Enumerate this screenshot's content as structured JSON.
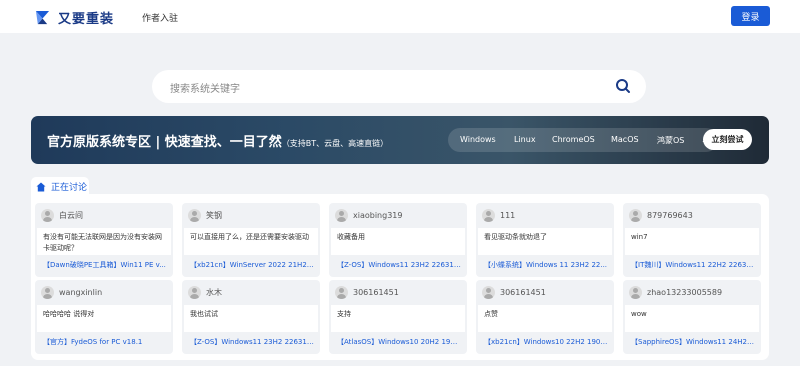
{
  "header": {
    "brand_text": "又要重装",
    "nav_link": "作者入驻",
    "login_label": "登录",
    "logo_icon": "brand-logo-icon"
  },
  "search": {
    "placeholder": "搜索系统关键字",
    "icon": "search-icon"
  },
  "banner": {
    "title": "官方原版系统专区 | 快速查找、一目了然",
    "subtitle": "（支持BT、云盘、高速直链）",
    "os_items": [
      "Windows",
      "Linux",
      "ChromeOS",
      "MacOS",
      "鸿蒙OS",
      "..."
    ],
    "try_label": "立刻尝试"
  },
  "discussion": {
    "tab_label": "正在讨论",
    "tab_icon": "house-icon",
    "cards": [
      {
        "user": "白云间",
        "comment": "有没有可能无法联网是因为没有安装网卡驱动呢？",
        "ref": "【Dawn破晓PE工具箱】Win11 PE v..."
      },
      {
        "user": "笑钢",
        "comment": "可以直接用了么，还是还需要安装驱动",
        "ref": "【xb21cn】WinServer 2022 21H2 ..."
      },
      {
        "user": "xiaobing319",
        "comment": "收藏备用",
        "ref": "【Z-OS】Windows11 23H2 22631...."
      },
      {
        "user": "111",
        "comment": "看见驱动条就劝退了",
        "ref": "【小蝶系统】Windows 11 23H2 22..."
      },
      {
        "user": "879769643",
        "comment": "win7",
        "ref": "【IT魏川】Windows11 22H2 22631..."
      },
      {
        "user": "wangxinlin",
        "comment": "哈哈哈哈 说得对",
        "ref": "【官方】FydeOS for PC v18.1"
      },
      {
        "user": "水木",
        "comment": "我也试试",
        "ref": "【Z-OS】Windows11 23H2 22631...."
      },
      {
        "user": "306161451",
        "comment": "支持",
        "ref": "【AtlasOS】Windows10 20H2 190..."
      },
      {
        "user": "306161451",
        "comment": "点赞",
        "ref": "【xb21cn】Windows10 22H2 1904..."
      },
      {
        "user": "zhao13233005589",
        "comment": "wow",
        "ref": "【SapphireOS】Windows11 24H2 ..."
      }
    ]
  },
  "colors": {
    "accent": "#1a5bd6",
    "brand": "#1a3a86",
    "background": "#f0f2f5"
  }
}
